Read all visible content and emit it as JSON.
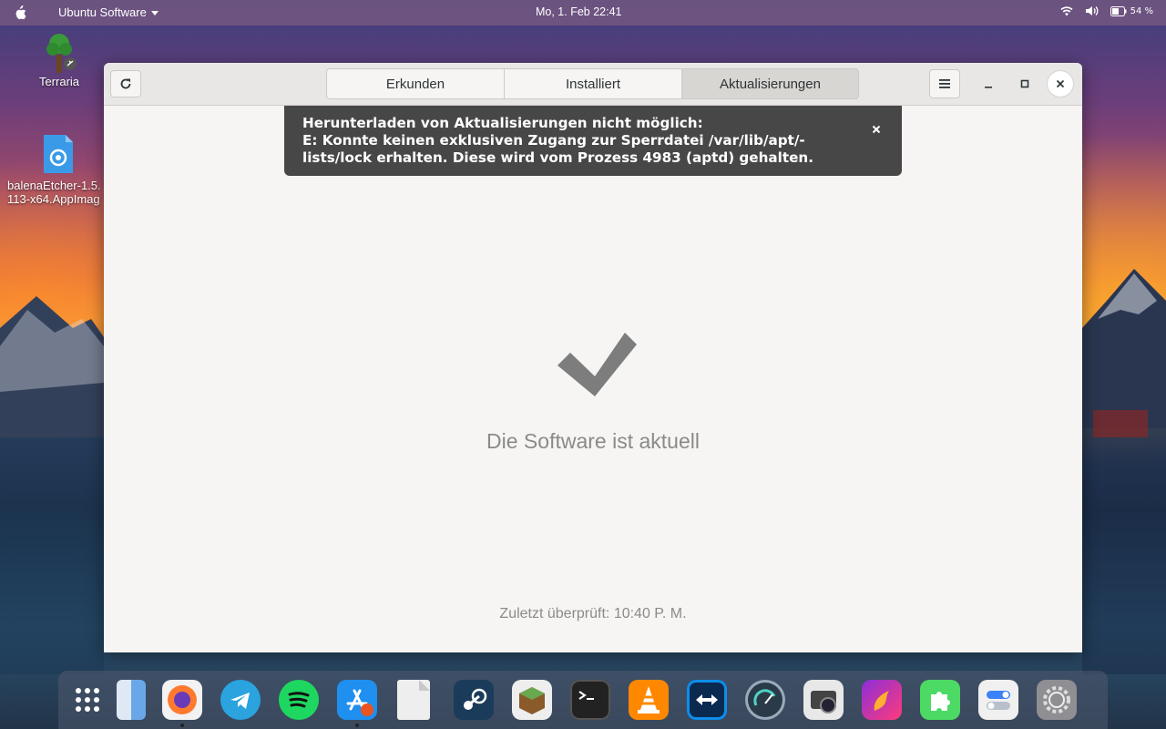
{
  "topbar": {
    "app_name": "Ubuntu Software",
    "clock": "Mo,  1. Feb  22:41",
    "battery": "54 %"
  },
  "desktop": {
    "icons": [
      {
        "label": "Terraria"
      },
      {
        "label_line1": "balenaEtcher-1.5.",
        "label_line2": "113-x64.AppImag"
      }
    ]
  },
  "window": {
    "tabs": [
      {
        "label": "Erkunden"
      },
      {
        "label": "Installiert"
      },
      {
        "label": "Aktualisierungen",
        "active": true
      }
    ],
    "notification": {
      "line1": "Herunterladen von Aktualisierungen nicht möglich:",
      "line2": "E: Konnte keinen exklusiven Zugang zur Sperrdatei /var/lib/apt/-",
      "line3": "lists/lock erhalten. Diese wird vom Prozess 4983 (aptd) gehalten."
    },
    "status_text": "Die Software ist aktuell",
    "last_checked": "Zuletzt überprüft: 10:40 P. M."
  },
  "dock": {
    "items": [
      {
        "name": "app-grid",
        "color": "#4a5568"
      },
      {
        "name": "finder",
        "color": "#6aa7e8"
      },
      {
        "name": "firefox",
        "color": "#ff7a2f",
        "running": true
      },
      {
        "name": "telegram",
        "color": "#2aa3df"
      },
      {
        "name": "spotify",
        "color": "#1ed760"
      },
      {
        "name": "app-store",
        "color": "#1f8ff0",
        "running": true
      },
      {
        "name": "document",
        "color": "#eeeeee"
      },
      {
        "name": "steam",
        "color": "#1b3b5a"
      },
      {
        "name": "minecraft",
        "color": "#6aa84f"
      },
      {
        "name": "terminal",
        "color": "#222222"
      },
      {
        "name": "vlc",
        "color": "#ff8800"
      },
      {
        "name": "teamviewer",
        "color": "#0e8ee9"
      },
      {
        "name": "stacer",
        "color": "#2a3a48"
      },
      {
        "name": "screenshot",
        "color": "#e8e8e8"
      },
      {
        "name": "firefox-dev",
        "color": "#8b2fd9"
      },
      {
        "name": "extensions",
        "color": "#4cd964"
      },
      {
        "name": "settings-toggles",
        "color": "#3b82f6"
      },
      {
        "name": "system-preferences",
        "color": "#8e8e93"
      }
    ]
  }
}
